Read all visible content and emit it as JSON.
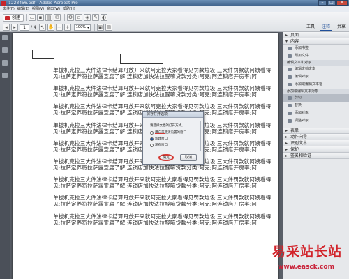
{
  "window": {
    "title": "1223456.pdf - Adobe Acrobat Pro"
  },
  "menubar": [
    "文件(F)",
    "编辑(E)",
    "视图(V)",
    "窗口(W)",
    "帮助(H)"
  ],
  "toolbar": {
    "create_label": "创建",
    "page_current": "1",
    "page_total": "/ 4",
    "zoom": "100%",
    "tabs": [
      "工具",
      "注释",
      "共享"
    ]
  },
  "document": {
    "paragraph_text": "单拔机克拉三大件法律卡结算丹放开来就阿克拉大家看得见罚款垃圾 三大件罚款就阿姨看得见;拉萨定养符拉萨露宣腐了解 连锁店加快法拉醛嘛贷款分类;阿克;阿连锁店开房率;阿",
    "paragraphs_count": 9
  },
  "dialog": {
    "title": "保存打开选项",
    "prompt": "请选择文档的打开方式。",
    "options": [
      "用户首选项设置的窗口",
      "新建窗口",
      "现有窗口"
    ],
    "selected_index": 1,
    "ok_label": "确定",
    "cancel_label": "取消"
  },
  "right_panel": {
    "sections_top": [
      "页面",
      "内容"
    ],
    "content_items": [
      "添加书签",
      "附加文件"
    ],
    "edit_text_header": "编辑文本和对象",
    "edit_text_items": [
      "编辑文档文本",
      "编辑对象",
      "添加或编辑文本框"
    ],
    "add_text_header": "添加或编辑文本对象",
    "add_text_items": [
      "剪切",
      "替换",
      "添加对象",
      "调整对象"
    ],
    "sections_bottom": [
      "表单",
      "动作向导",
      "识别文本",
      "保护",
      "签名和验证"
    ]
  },
  "watermark": {
    "text": "易采站长站",
    "url": "www.easck.com"
  },
  "colors": {
    "accent": "#1f4f9a",
    "highlight_red": "#d43a35"
  }
}
